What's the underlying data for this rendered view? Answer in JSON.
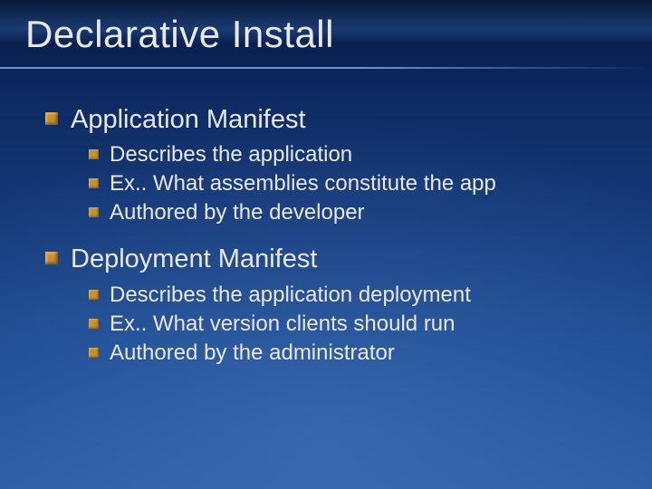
{
  "title": "Declarative Install",
  "sections": [
    {
      "heading": "Application Manifest",
      "items": [
        "Describes the application",
        "Ex.. What assemblies constitute the app",
        "Authored by the developer"
      ]
    },
    {
      "heading": "Deployment Manifest",
      "items": [
        "Describes the application deployment",
        "Ex.. What version clients should run",
        "Authored by the administrator"
      ]
    }
  ]
}
